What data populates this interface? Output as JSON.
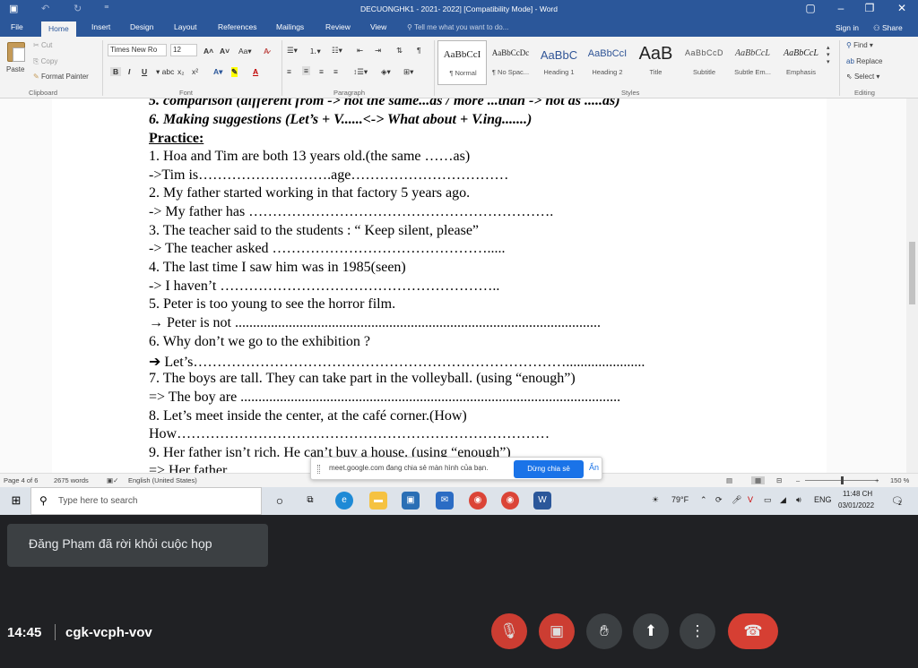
{
  "word": {
    "title": "DECUONGHK1 - 2021- 2022] [Compatibility Mode] - Word",
    "tabs": [
      "File",
      "Home",
      "Insert",
      "Design",
      "Layout",
      "References",
      "Mailings",
      "Review",
      "View"
    ],
    "tell_me": "Tell me what you want to do...",
    "sign_in": "Sign in",
    "share": "Share",
    "clipboard": {
      "paste": "Paste",
      "cut": "Cut",
      "copy": "Copy",
      "format_painter": "Format Painter",
      "group": "Clipboard"
    },
    "font": {
      "name": "Times New Ro",
      "size": "12",
      "group": "Font"
    },
    "paragraph_group": "Paragraph",
    "styles": [
      {
        "sample": "AaBbCcI",
        "name": "¶ Normal"
      },
      {
        "sample": "AaBbCcDc",
        "name": "¶ No Spac..."
      },
      {
        "sample": "AaBbC",
        "name": "Heading 1"
      },
      {
        "sample": "AaBbCcI",
        "name": "Heading 2"
      },
      {
        "sample": "AaB",
        "name": "Title"
      },
      {
        "sample": "AaBbCcD",
        "name": "Subtitle"
      },
      {
        "sample": "AaBbCcL",
        "name": "Subtle Em..."
      },
      {
        "sample": "AaBbCcL",
        "name": "Emphasis"
      }
    ],
    "styles_group": "Styles",
    "editing": {
      "find": "Find",
      "replace": "Replace",
      "select": "Select",
      "group": "Editing"
    }
  },
  "document": {
    "lines": [
      "5. comparison (different from -> not the same...as / more ...than -> not as .....as)",
      "6. Making suggestions (Let’s + V......<-> What about + V.ing.......)",
      "Practice:",
      "1. Hoa and Tim are both 13 years old.(the same ……as)",
      " ->Tim is……………………….age……………………………",
      "2. My father started working in that factory 5 years ago.",
      "->  My father has ……………………………………………………….",
      "3. The teacher said to the students : “ Keep silent, please”",
      "->   The teacher asked ……………………………………….....",
      "4. The last time I saw him was in 1985(seen)",
      "->  I haven’t …………………………………………………..",
      "5. Peter is too young to see the horror film.",
      "→ Peter is not ......................................................................................................",
      " 6. Why don’t we  go to the exhibition ?",
      "➔  Let’s……………………………………………………………………......................",
      "7.  The boys are tall. They can take part in the volleyball. (using “enough”)",
      "=> The boy are ..........................................................................................................",
      "8. Let’s meet inside the center, at the café corner.(How)",
      "How……………………………………………………………………",
      "9. Her father isn’t rich. He can’t buy a house. (using “enough”)",
      "=> Her father"
    ]
  },
  "status": {
    "page": "Page 4 of 6",
    "words": "2675 words",
    "language": "English (United States)",
    "zoom": "150 %"
  },
  "share_bar": {
    "message": "meet.google.com đang chia sẻ màn hình của bạn.",
    "stop_label": "Dừng chia sẻ",
    "hide_label": "Ẩn"
  },
  "taskbar": {
    "search_placeholder": "Type here to search",
    "weather": "79°F",
    "lang": "ENG",
    "time": "11:48 CH",
    "date": "03/01/2022",
    "notif_count": "2"
  },
  "meet": {
    "toast": "Đăng Phạm đã rời khỏi cuộc họp",
    "time": "14:45",
    "code": "cgk-vcph-vov"
  },
  "colors": {
    "word_blue": "#2b579a",
    "meet_red": "#ea4335",
    "meet_bg": "#202124"
  }
}
